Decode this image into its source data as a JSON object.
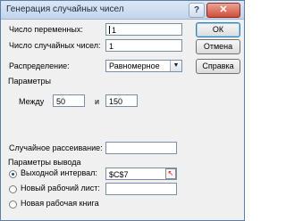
{
  "window": {
    "title": "Генерация случайных чисел",
    "help_label": "?",
    "close_label": "✕"
  },
  "form": {
    "num_vars_label": "Число переменных:",
    "num_vars_value": "1",
    "num_random_label": "Число случайных чисел:",
    "num_random_value": "1",
    "distribution_label": "Распределение:",
    "distribution_value": "Равномерное",
    "distribution_arrow": "▼",
    "params_label": "Параметры",
    "between_label": "Между",
    "between_from": "50",
    "and_label": "и",
    "between_to": "150",
    "seed_label": "Случайное рассеивание:",
    "seed_value": "",
    "output_params_label": "Параметры вывода",
    "output_range_label": "Выходной интервал:",
    "output_range_value": "$C$7",
    "new_sheet_label": "Новый рабочий лист:",
    "new_sheet_value": "",
    "new_book_label": "Новая рабочая книга"
  },
  "buttons": {
    "ok": "ОК",
    "cancel": "Отмена",
    "help": "Справка"
  },
  "colors": {
    "accent": "#3c7fb1",
    "close": "#cf4f3a"
  }
}
